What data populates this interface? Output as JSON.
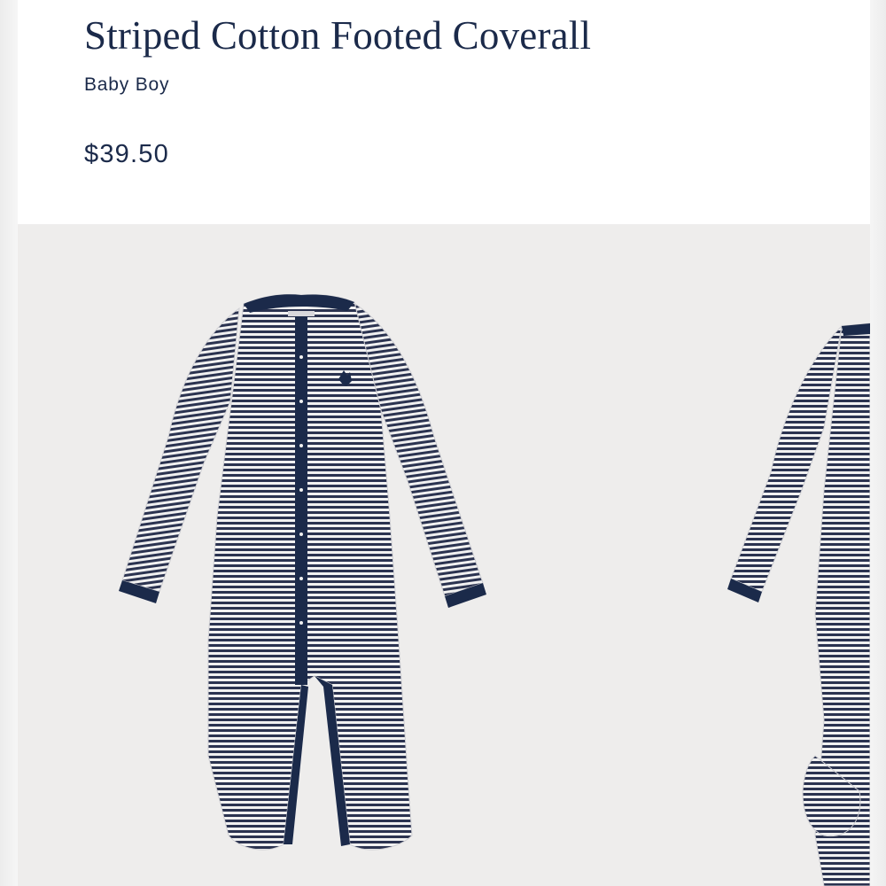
{
  "product": {
    "title": "Striped Cotton Footed Coverall",
    "category": "Baby Boy",
    "price": "$39.50"
  },
  "gallery": {
    "images": [
      {
        "name": "coverall-front-view"
      },
      {
        "name": "coverall-side-view"
      }
    ]
  },
  "colors": {
    "navy": "#1b2a4a",
    "stripe_navy": "#2b3350",
    "stripe_white": "#f1f1f1",
    "image_bg": "#eeedec"
  }
}
